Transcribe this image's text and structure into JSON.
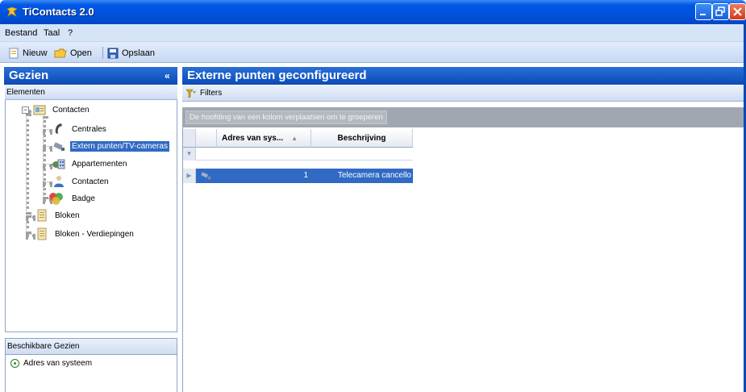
{
  "window": {
    "title": "TiContacts 2.0",
    "buttons": [
      "minimize",
      "maximize",
      "close"
    ]
  },
  "menu": {
    "items": [
      "Bestand",
      "Taal",
      "?"
    ]
  },
  "toolbar": {
    "new_label": "Nieuw",
    "open_label": "Open",
    "save_label": "Opslaan"
  },
  "left_panel": {
    "title": "Gezien",
    "collapse_glyph": "«",
    "section_label": "Elementen",
    "tree": {
      "root": "Contacten",
      "children": [
        "Centrales",
        "Extern punten/TV-cameras",
        "Appartementen",
        "Contacten",
        "Badge"
      ],
      "top_level": [
        "Bloken",
        "Bloken - Verdiepingen"
      ],
      "selected": "Extern punten/TV-cameras"
    },
    "available_views": {
      "header": "Beschikbare Gezien",
      "options": [
        "Adres van systeem"
      ],
      "selected": "Adres van systeem"
    }
  },
  "right_panel": {
    "title": "Externe punten geconfigureerd",
    "filters_label": "Filters",
    "group_hint": "De hoofding van een kolom verplaatsen om te groeperen",
    "grid": {
      "columns": [
        "Adres van sys...",
        "Beschrijving"
      ],
      "sort_glyph": "▲",
      "rows": [
        {
          "address": "1",
          "description": "Telecamera cancello"
        }
      ],
      "selected_row_color": "#316ac5"
    }
  },
  "colors": {
    "header_blue": "#0b4bb5",
    "selection_blue": "#316ac5",
    "group_bar_gray": "#a1a7b0"
  }
}
